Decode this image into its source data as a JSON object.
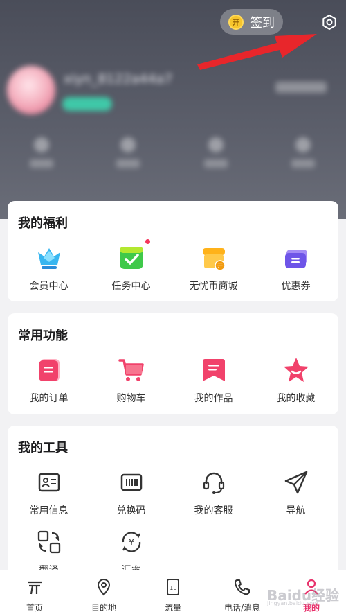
{
  "header": {
    "signin_label": "签到",
    "coin_glyph": "开",
    "username": "xiyn_8122a44a7",
    "stats": [
      "",
      "",
      "",
      ""
    ]
  },
  "welfare": {
    "title": "我的福利",
    "items": [
      {
        "label": "会员中心",
        "icon": "crown-icon"
      },
      {
        "label": "任务中心",
        "icon": "task-check-icon"
      },
      {
        "label": "无忧币商城",
        "icon": "coin-store-icon"
      },
      {
        "label": "优惠券",
        "icon": "coupon-icon"
      }
    ]
  },
  "common": {
    "title": "常用功能",
    "items": [
      {
        "label": "我的订单",
        "icon": "order-icon"
      },
      {
        "label": "购物车",
        "icon": "cart-icon"
      },
      {
        "label": "我的作品",
        "icon": "works-icon"
      },
      {
        "label": "我的收藏",
        "icon": "star-icon"
      }
    ]
  },
  "tools": {
    "title": "我的工具",
    "items": [
      {
        "label": "常用信息",
        "icon": "id-card-icon"
      },
      {
        "label": "兑换码",
        "icon": "barcode-icon"
      },
      {
        "label": "我的客服",
        "icon": "headset-icon"
      },
      {
        "label": "导航",
        "icon": "paper-plane-icon"
      },
      {
        "label": "翻译",
        "icon": "translate-icon"
      },
      {
        "label": "汇率",
        "icon": "exchange-rate-icon"
      }
    ]
  },
  "bottom_nav": [
    {
      "label": "首页",
      "icon": "home-icon"
    },
    {
      "label": "目的地",
      "icon": "location-pin-icon"
    },
    {
      "label": "流量",
      "icon": "sim-card-icon"
    },
    {
      "label": "电话/消息",
      "icon": "phone-icon"
    },
    {
      "label": "我的",
      "icon": "profile-icon",
      "active": true
    }
  ],
  "watermark": {
    "text": "Baidu经验",
    "sub": "jingyan.baidu.com"
  },
  "colors": {
    "accent": "#e8316b",
    "header_bg": "#55585f",
    "arrow": "#e8262b"
  }
}
